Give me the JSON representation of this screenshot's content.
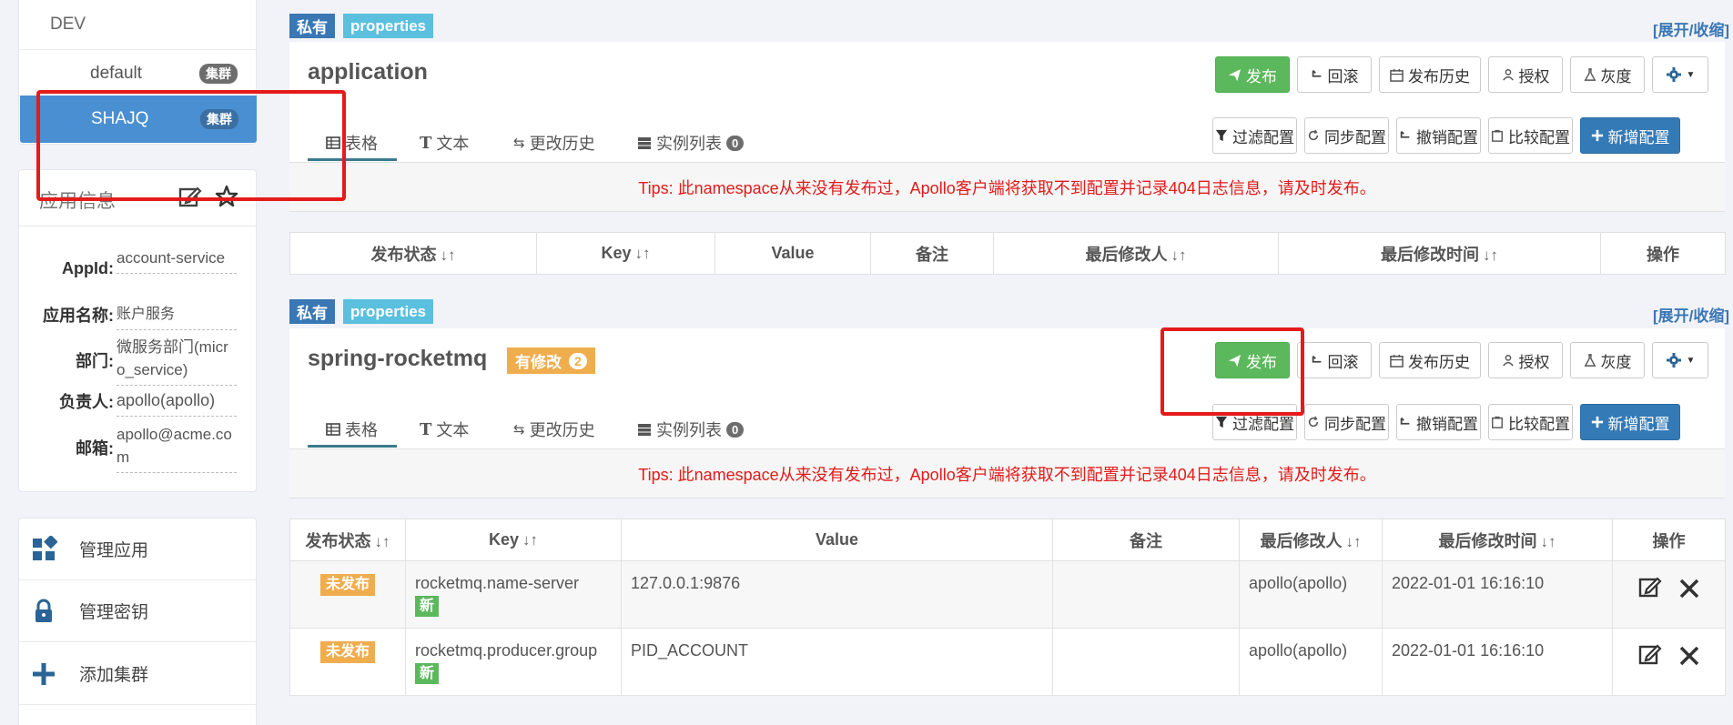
{
  "sidebar": {
    "env": "DEV",
    "clusters": [
      {
        "name": "default",
        "badge": "集群"
      },
      {
        "name": "SHAJQ",
        "badge": "集群"
      }
    ],
    "app_info": {
      "title": "应用信息",
      "fields": [
        {
          "label": "AppId:",
          "value": "account-service"
        },
        {
          "label": "应用名称:",
          "value": "账户服务"
        },
        {
          "label": "部门:",
          "value": "微服务部门(micro_service)"
        },
        {
          "label": "负责人:",
          "value": "apollo(apollo)"
        },
        {
          "label": "邮箱:",
          "value": "apollo@acme.com"
        }
      ]
    },
    "menu": [
      {
        "label": "管理应用",
        "icon": "grid-icon"
      },
      {
        "label": "管理密钥",
        "icon": "lock-icon"
      },
      {
        "label": "添加集群",
        "icon": "plus-icon"
      }
    ]
  },
  "common": {
    "tag_private": "私有",
    "tag_properties": "properties",
    "expand_link": "[展开/收缩]",
    "buttons": {
      "publish": "发布",
      "rollback": "回滚",
      "history": "发布历史",
      "authorize": "授权",
      "gray": "灰度",
      "filter": "过滤配置",
      "sync": "同步配置",
      "revoke": "撤销配置",
      "compare": "比较配置",
      "add": "新增配置"
    },
    "tabs": {
      "table": "表格",
      "text": "文本",
      "history": "更改历史",
      "instances": "实例列表",
      "instances_count": "0"
    },
    "tips": "Tips: 此namespace从来没有发布过，Apollo客户端将获取不到配置并记录404日志信息，请及时发布。",
    "columns": [
      "发布状态",
      "Key",
      "Value",
      "备注",
      "最后修改人",
      "最后修改时间",
      "操作"
    ]
  },
  "namespaces": [
    {
      "name": "application"
    },
    {
      "name": "spring-rocketmq",
      "modified_label": "有修改",
      "modified_count": "2",
      "rows": [
        {
          "status": "未发布",
          "key": "rocketmq.name-server",
          "new": "新",
          "value": "127.0.0.1:9876",
          "comment": "",
          "modifier": "apollo(apollo)",
          "time": "2022-01-01 16:16:10"
        },
        {
          "status": "未发布",
          "key": "rocketmq.producer.group",
          "new": "新",
          "value": "PID_ACCOUNT",
          "comment": "",
          "modifier": "apollo(apollo)",
          "time": "2022-01-01 16:16:10"
        }
      ]
    }
  ]
}
